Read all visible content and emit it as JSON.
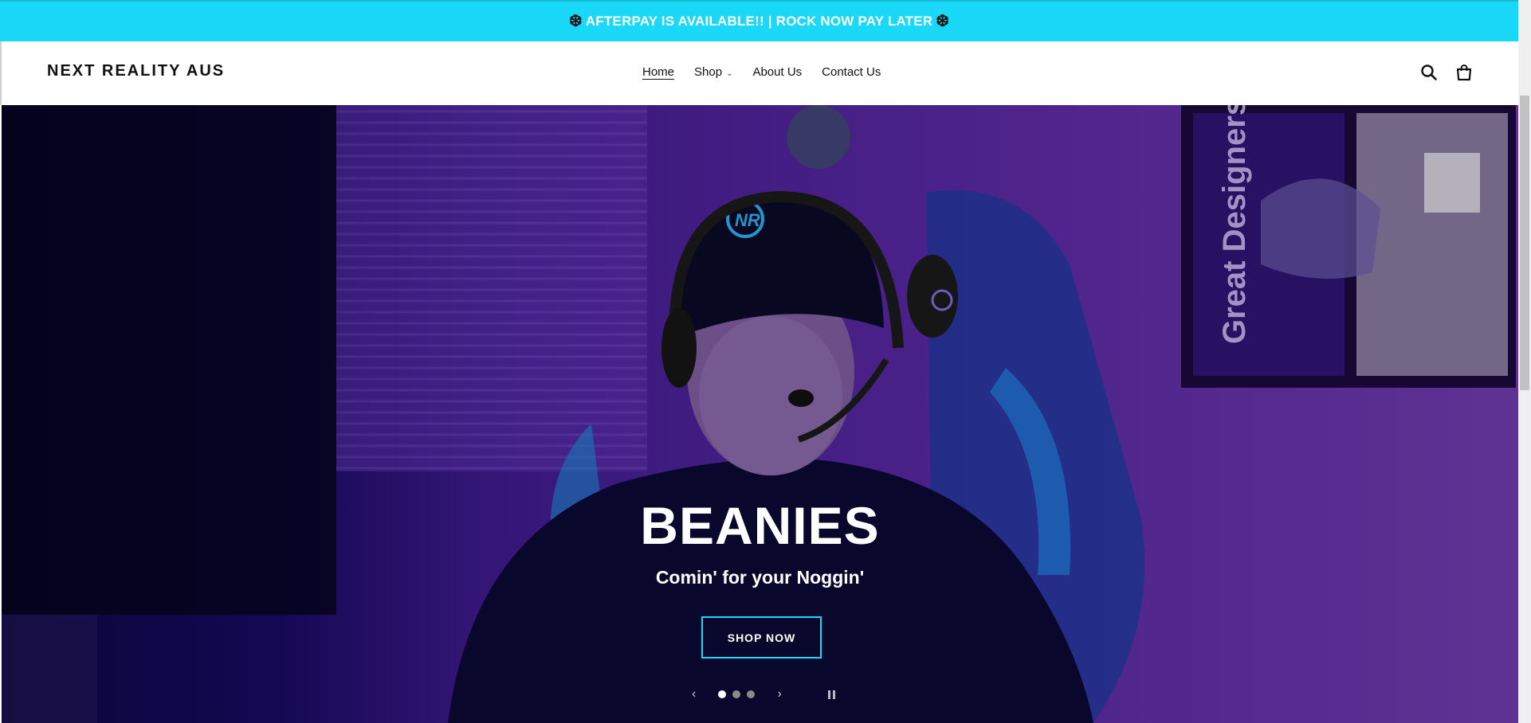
{
  "announcement": {
    "text": "AFTERPAY IS AVAILABLE!! | ROCK NOW PAY LATER",
    "flake_icon": "❆"
  },
  "header": {
    "logo": "NEXT REALITY AUS",
    "nav": {
      "home": "Home",
      "shop": "Shop",
      "about": "About Us",
      "contact": "Contact Us"
    },
    "icons": [
      "search-icon",
      "cart-icon"
    ]
  },
  "hero": {
    "title": "BEANIES",
    "subtitle": "Comin' for your Noggin'",
    "cta": "SHOP NOW",
    "poster_text": "Great Designers",
    "beanie_logo": "NR",
    "slides_total": 3,
    "slide_active": 1
  },
  "colors": {
    "accent": "#1ad8f7",
    "hero_purple": "#4d2296"
  }
}
